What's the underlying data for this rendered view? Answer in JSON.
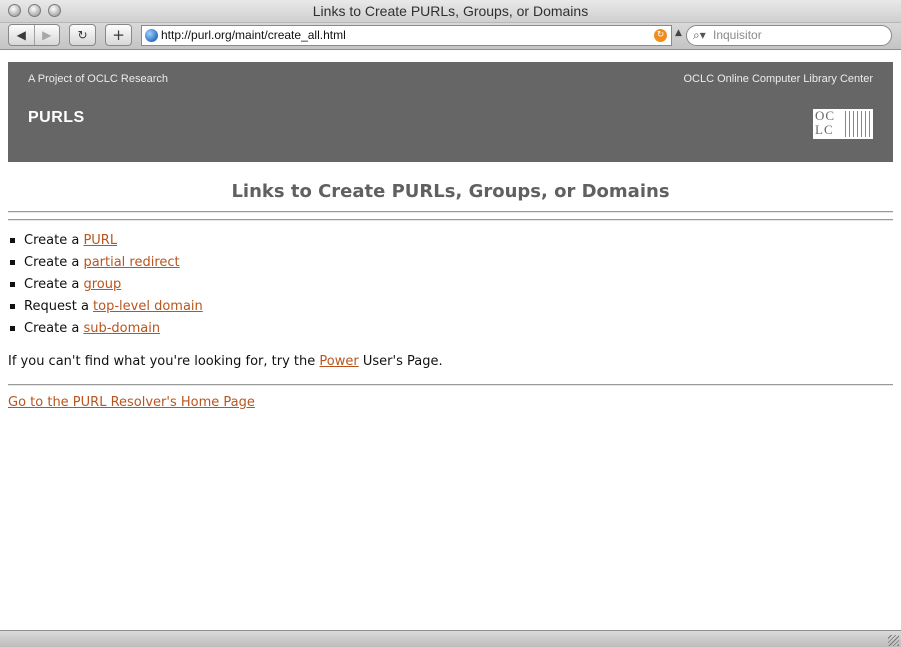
{
  "window": {
    "title": "Links to Create PURLs, Groups, or Domains"
  },
  "toolbar": {
    "url": "http://purl.org/maint/create_all.html",
    "search_placeholder": "Inquisitor"
  },
  "banner": {
    "project": "A Project of OCLC Research",
    "organization": "OCLC Online Computer Library Center",
    "site_name": "PURLS",
    "logo_text": "OC LC"
  },
  "main": {
    "heading": "Links to Create PURLs, Groups, or Domains",
    "links": [
      {
        "prefix": "Create a",
        "link": "PURL"
      },
      {
        "prefix": "Create a",
        "link": "partial redirect"
      },
      {
        "prefix": "Create a",
        "link": "group"
      },
      {
        "prefix": "Request a",
        "link": "top-level domain"
      },
      {
        "prefix": "Create a",
        "link": "sub-domain"
      }
    ],
    "hint": {
      "before": "If you can't find what you're looking for, try the",
      "link": "Power",
      "after": "User's Page."
    },
    "home_link": "Go to the PURL Resolver's Home Page "
  },
  "colors": {
    "banner": "#666666",
    "link": "#b8551e",
    "heading": "#606060"
  }
}
